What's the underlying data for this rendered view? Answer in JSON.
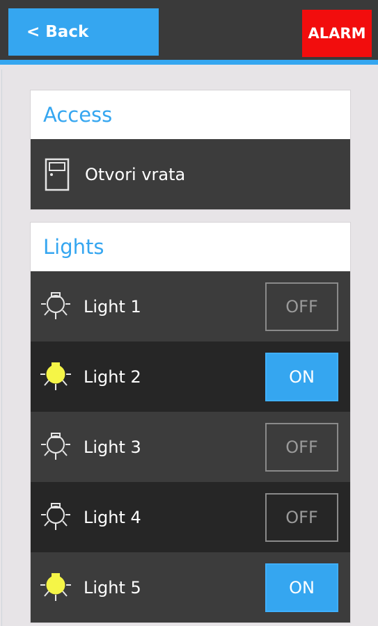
{
  "topbar": {
    "back_label": "< Back",
    "alarm_label": "ALARM"
  },
  "access": {
    "title": "Access",
    "item": {
      "label": "Otvori vrata",
      "icon": "door-icon"
    }
  },
  "lights": {
    "title": "Lights",
    "items": [
      {
        "label": "Light 1",
        "state": "OFF",
        "icon": "bulb-off-icon"
      },
      {
        "label": "Light 2",
        "state": "ON",
        "icon": "bulb-on-icon"
      },
      {
        "label": "Light 3",
        "state": "OFF",
        "icon": "bulb-off-icon"
      },
      {
        "label": "Light 4",
        "state": "OFF",
        "icon": "bulb-off-icon"
      },
      {
        "label": "Light 5",
        "state": "ON",
        "icon": "bulb-on-icon"
      }
    ]
  },
  "colors": {
    "accent": "#35a6f0",
    "alarm": "#f20d0d",
    "bulb_on": "#f5f547"
  }
}
